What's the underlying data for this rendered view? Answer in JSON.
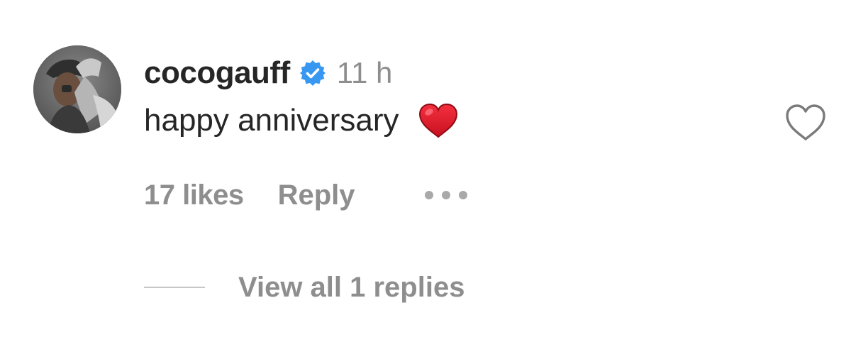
{
  "comment": {
    "username": "cocogauff",
    "verified": true,
    "time": "11 h",
    "text": "happy anniversary",
    "emoji": "red-heart",
    "likes": "17 likes",
    "reply_label": "Reply",
    "more_icon": "more-dots-icon",
    "like_icon": "heart-outline-icon",
    "view_replies": "View all 1 replies"
  },
  "colors": {
    "primary_text": "#262626",
    "secondary_text": "#8e8e8e",
    "verified_blue": "#3897f0",
    "heart_red": "#e0162b"
  }
}
